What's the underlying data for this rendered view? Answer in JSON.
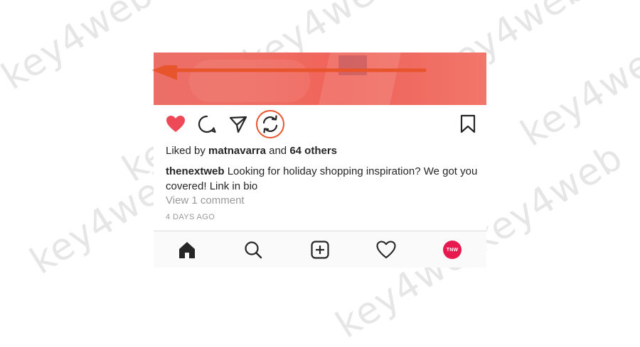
{
  "watermark": {
    "text": "key4web"
  },
  "post": {
    "likes_prefix": "Liked by",
    "liked_by_user": "matnavarra",
    "likes_joiner": "and",
    "others_count": "64 others",
    "caption_user": "thenextweb",
    "caption_text": "Looking for holiday shopping inspiration? We got you covered! Link in bio",
    "view_comments": "View 1 comment",
    "timestamp": "4 DAYS AGO"
  },
  "action_bar": {
    "icons": [
      "heart-icon",
      "comment-icon",
      "share-icon",
      "repost-icon",
      "bookmark-icon"
    ],
    "like_color": "#ed4956",
    "highlight_color": "#e8542c"
  },
  "tab_bar": {
    "icons": [
      "home-icon",
      "search-icon",
      "add-post-icon",
      "activity-icon",
      "profile-avatar"
    ],
    "profile_label": "TNW",
    "profile_color": "#e8194f"
  }
}
